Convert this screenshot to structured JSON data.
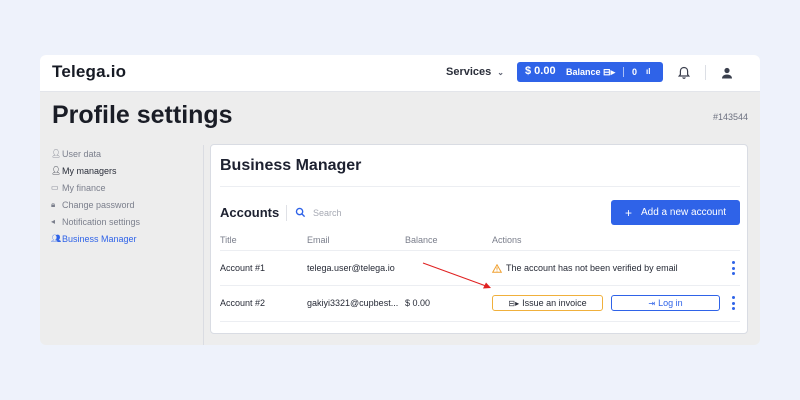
{
  "header": {
    "logo": "Telega.io",
    "services_label": "Services",
    "balance_amount": "$ 0.00",
    "balance_label": "Balance",
    "balance_count": "0"
  },
  "page": {
    "title": "Profile settings",
    "id": "#143544"
  },
  "sidebar": {
    "items": [
      {
        "label": "User data",
        "icon": "user-icon"
      },
      {
        "label": "My managers",
        "icon": "managers-icon"
      },
      {
        "label": "My finance",
        "icon": "card-icon"
      },
      {
        "label": "Change password",
        "icon": "lock-icon"
      },
      {
        "label": "Notification settings",
        "icon": "megaphone-icon"
      },
      {
        "label": "Business Manager",
        "icon": "group-icon"
      }
    ]
  },
  "card": {
    "title": "Business Manager",
    "accounts_heading": "Accounts",
    "search_placeholder": "Search",
    "add_button": "Add a new account",
    "columns": [
      "Title",
      "Email",
      "Balance",
      "Actions"
    ],
    "rows": [
      {
        "title": "Account #1",
        "email": "telega.user@telega.io",
        "balance": "",
        "warning": "The account has not been verified by email"
      },
      {
        "title": "Account #2",
        "email": "gakiyi3321@cupbest...",
        "balance": "$ 0.00",
        "invoice": "Issue an invoice",
        "login": "Log in"
      }
    ]
  },
  "colors": {
    "accent": "#2f63e8",
    "warning": "#f0b03c",
    "arrow": "#e02020"
  }
}
